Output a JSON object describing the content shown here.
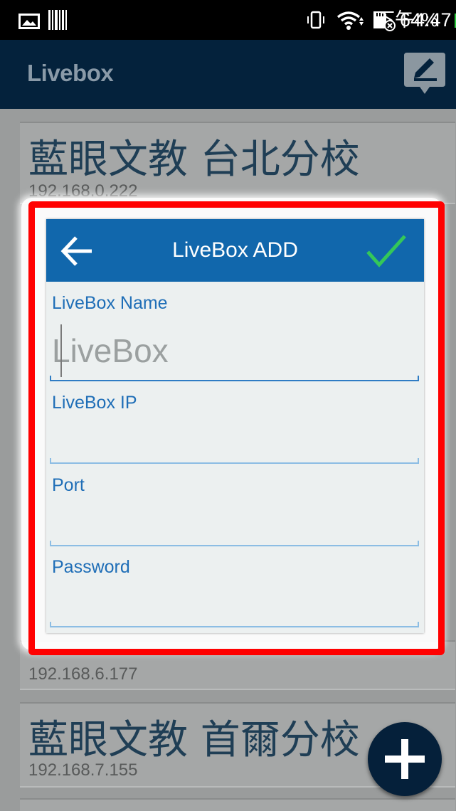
{
  "status_bar": {
    "icons": [
      "photo-icon",
      "barcode-icon",
      "vibrate-icon",
      "wifi-icon",
      "sd-card-icon",
      "battery-charging-icon"
    ],
    "battery": "64%",
    "time": "下午4:47"
  },
  "app_bar": {
    "title": "Livebox",
    "edit_icon": "edit-icon"
  },
  "list": {
    "items": [
      {
        "name": "藍眼文教 台北分校",
        "ip": "192.168.0.222"
      },
      {
        "name": "",
        "ip": "192.168.6.177"
      },
      {
        "name": "藍眼文教 首爾分校",
        "ip": "192.168.7.155"
      }
    ]
  },
  "fab_icon": "plus-icon",
  "dialog": {
    "title": "LiveBox ADD",
    "back_icon": "back-arrow-icon",
    "confirm_icon": "checkmark-icon",
    "fields": {
      "name": {
        "label": "LiveBox Name",
        "placeholder": "LiveBox",
        "value": ""
      },
      "ip": {
        "label": "LiveBox IP",
        "value": ""
      },
      "port": {
        "label": "Port",
        "value": ""
      },
      "password": {
        "label": "Password",
        "value": ""
      }
    }
  },
  "colors": {
    "highlight": "#ff0000",
    "header_blue": "#1167ac",
    "confirm_green": "#34c759",
    "label_blue": "#1f6eb7"
  }
}
